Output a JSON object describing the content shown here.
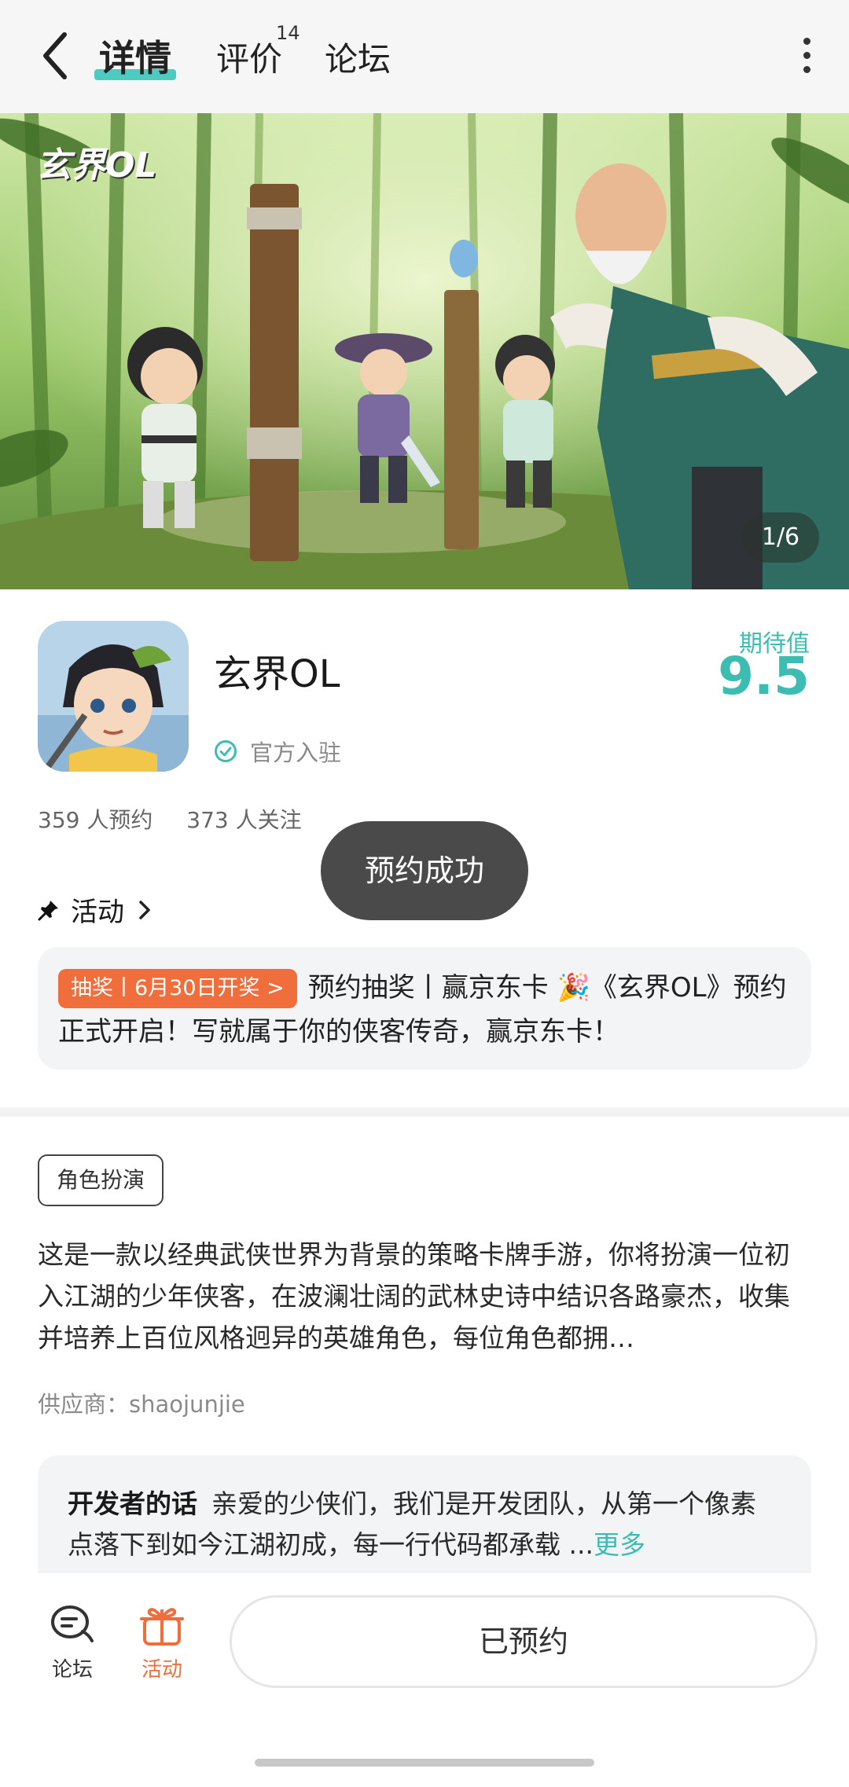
{
  "header": {
    "tabs": [
      {
        "label": "详情",
        "active": true
      },
      {
        "label": "评价",
        "badge": "14"
      },
      {
        "label": "论坛"
      }
    ]
  },
  "banner": {
    "logo_text": "玄界OL",
    "page_indicator": "1/6"
  },
  "game": {
    "title": "玄界OL",
    "official_label": "官方入驻",
    "expect_label": "期待值",
    "expect_score": "9.5",
    "reservations": "359 人预约",
    "followers": "373 人关注"
  },
  "toast": "预约成功",
  "activity": {
    "heading": "活动",
    "badge": "抽奖丨6月30日开奖 >",
    "text": "预约抽奖丨赢京东卡 🎉《玄界OL》预约正式开启！写就属于你的侠客传奇，赢京东卡！"
  },
  "tag": "角色扮演",
  "description": "这是一款以经典武侠世界为背景的策略卡牌手游，你将扮演一位初入江湖的少年侠客，在波澜壮阔的武林史诗中结识各路豪杰，收集并培养上百位风格迥异的英雄角色，每位角色都拥…",
  "supplier": "供应商：shaojunjie",
  "developer_note": {
    "heading": "开发者的话",
    "text": "亲爱的少侠们，我们是开发团队，从第一个像素点落下到如今江湖初成，每一行代码都承载 ...",
    "more": "更多"
  },
  "bottom_nav": {
    "forum_label": "论坛",
    "activity_label": "活动",
    "reserved_label": "已预约"
  },
  "colors": {
    "accent": "#3dbdb2",
    "orange": "#f06d3c",
    "toast_bg": "#4a4a4a"
  }
}
